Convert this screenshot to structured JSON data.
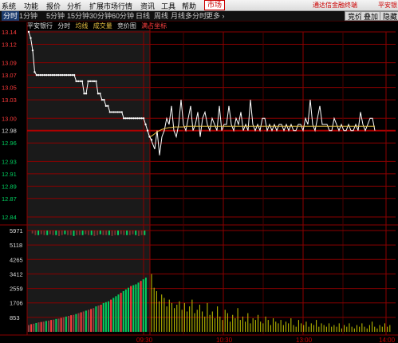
{
  "menu": {
    "items": [
      "系统",
      "功能",
      "报价",
      "分析",
      "扩展市场行情",
      "资讯",
      "工具",
      "帮助"
    ],
    "active_item": "市场",
    "right_text": "通达信金融终端",
    "right_text2": "平安银"
  },
  "toolbar": {
    "periods": [
      "分时",
      "1分钟",
      "5分钟",
      "15分钟",
      "30分钟",
      "60分钟",
      "日线",
      "周线",
      "月线",
      "多分时",
      "更多"
    ],
    "selected": "分时",
    "more_suffix": "›",
    "buttons": [
      "竞价",
      "叠加",
      "隐藏"
    ]
  },
  "info": {
    "stock_name": "平安银行",
    "mode": "分时",
    "avg_line": "均线",
    "volume": "成交量",
    "auction": "竞价图",
    "coord": "满占坐标"
  },
  "colors": {
    "up": "#ff3c3c",
    "down": "#00d060",
    "price_line": "#ffffff",
    "avg_line": "#e8c040",
    "grid": "#8b0000",
    "auction_bg": "#1a1a1a",
    "volume_bar": "#c8c800",
    "auction_volume": "#7a3030"
  },
  "chart_data": {
    "type": "line",
    "price_ticks": [
      "13.14",
      "13.12",
      "13.09",
      "13.07",
      "13.05",
      "13.03",
      "13.00",
      "12.98",
      "12.96",
      "12.93",
      "12.91",
      "12.89",
      "12.87",
      "12.84"
    ],
    "reference_price": 12.98,
    "volume_ticks": [
      "5971",
      "5118",
      "4265",
      "3412",
      "2559",
      "1706",
      "853"
    ],
    "time_labels": [
      "09:30",
      "10:30",
      "13:00",
      "14:00"
    ],
    "auction_price": [
      13.14,
      13.13,
      13.11,
      13.075,
      13.07,
      13.07,
      13.07,
      13.07,
      13.07,
      13.07,
      13.07,
      13.07,
      13.07,
      13.07,
      13.07,
      13.07,
      13.07,
      13.07,
      13.07,
      13.07,
      13.07,
      13.07,
      13.07,
      13.07,
      13.06,
      13.06,
      13.06,
      13.06,
      13.04,
      13.04,
      13.06,
      13.06,
      13.06,
      13.06,
      13.06,
      13.04,
      13.04,
      13.03,
      13.03,
      13.02,
      13.02,
      13.01,
      13.01,
      13.01,
      13.01,
      13.01,
      13.01,
      13.01,
      13.0,
      13.0,
      13.0,
      13.0,
      13.0,
      13.0,
      13.0,
      13.0,
      13.0,
      13.0,
      13.0,
      12.99,
      12.98,
      12.97,
      12.965
    ],
    "session_price": [
      12.97,
      12.96,
      12.95,
      12.98,
      12.94,
      12.97,
      12.98,
      13.0,
      12.99,
      13.02,
      12.98,
      12.97,
      12.99,
      13.03,
      12.99,
      12.98,
      13.0,
      13.02,
      12.98,
      12.99,
      13.01,
      12.97,
      13.0,
      13.01,
      12.99,
      12.98,
      13.0,
      12.99,
      12.98,
      13.02,
      12.98,
      12.99,
      12.99,
      13.02,
      12.99,
      12.98,
      13.0,
      12.99,
      13.01,
      12.98,
      12.99,
      12.98,
      13.03,
      12.99,
      12.98,
      12.99,
      12.98,
      13.0,
      13.0,
      12.98,
      12.99,
      12.98,
      12.99,
      12.98,
      12.99,
      12.99,
      12.98,
      12.99,
      12.98,
      12.99,
      12.98,
      12.98,
      12.99,
      12.99,
      12.98,
      13.0,
      12.99,
      13.03,
      12.99,
      12.98,
      13.0,
      13.02,
      12.99,
      12.99,
      12.99,
      12.98,
      12.98,
      13.0,
      12.99,
      12.98,
      12.99,
      12.98,
      12.98,
      12.99,
      12.98,
      12.98,
      12.99,
      12.98,
      13.01,
      12.99,
      12.98,
      12.99,
      13.0,
      13.0,
      12.98
    ],
    "session_avg": [
      12.97,
      12.972,
      12.975,
      12.978,
      12.98,
      12.982,
      12.983,
      12.984,
      12.985,
      12.985,
      12.986,
      12.986,
      12.986,
      12.986,
      12.986,
      12.987,
      12.987,
      12.987,
      12.987,
      12.987,
      12.987,
      12.987,
      12.987,
      12.987,
      12.987,
      12.987,
      12.987,
      12.987,
      12.987,
      12.987,
      12.987,
      12.987,
      12.987,
      12.987,
      12.987,
      12.987,
      12.987,
      12.987,
      12.987,
      12.987,
      12.987,
      12.987,
      12.987,
      12.987,
      12.987,
      12.987,
      12.987,
      12.987,
      12.987,
      12.987,
      12.987,
      12.987,
      12.987,
      12.987,
      12.987,
      12.987,
      12.987,
      12.987,
      12.987,
      12.987,
      12.987,
      12.987,
      12.987,
      12.987,
      12.987,
      12.987,
      12.987,
      12.987,
      12.987,
      12.987,
      12.987,
      12.987,
      12.987,
      12.987,
      12.987,
      12.987,
      12.987,
      12.987,
      12.987,
      12.987,
      12.987,
      12.987,
      12.987,
      12.987,
      12.987,
      12.987,
      12.987,
      12.987,
      12.987,
      12.987,
      12.987,
      12.987,
      12.987,
      12.987,
      12.987
    ],
    "auction_volume_top": [
      5971,
      5800,
      5700,
      5700,
      5750,
      5700,
      5700,
      5750,
      5700,
      5700,
      5650,
      5700,
      5750,
      5700,
      5700,
      5650,
      5700,
      5700,
      5700,
      5750,
      5700,
      5700,
      5650,
      5700,
      5750,
      5700,
      5700,
      5700,
      5650,
      5700,
      5700,
      5750,
      5700,
      5700,
      5700,
      5750,
      5700,
      5650,
      5700,
      5700
    ],
    "auction_volume_bottom": [
      400,
      450,
      480,
      520,
      560,
      580,
      600,
      640,
      660,
      700,
      720,
      760,
      780,
      820,
      860,
      900,
      940,
      980,
      1000,
      1050,
      1100,
      1150,
      1200,
      1250,
      1300,
      1350,
      1400,
      1500,
      1550,
      1600,
      1700,
      1750,
      1800,
      1900,
      2000,
      2100,
      2200,
      2300,
      2400,
      2500,
      2600,
      2700,
      2750,
      2800,
      2900,
      3000,
      3100,
      3200
    ],
    "session_volume": [
      3400,
      2600,
      2400,
      1800,
      2200,
      2000,
      1500,
      1900,
      1700,
      1400,
      1600,
      1800,
      1300,
      1700,
      1200,
      1500,
      1900,
      1100,
      1300,
      1600,
      1200,
      900,
      1700,
      1000,
      1200,
      800,
      1500,
      900,
      700,
      1300,
      1100,
      600,
      1000,
      800,
      1400,
      700,
      900,
      600,
      1100,
      500,
      800,
      700,
      1000,
      600,
      500,
      900,
      700,
      400,
      800,
      600,
      500,
      700,
      400,
      600,
      500,
      800,
      400,
      300,
      700,
      500,
      400,
      600,
      300,
      500,
      400,
      700,
      300,
      500,
      400,
      300,
      500,
      300,
      400,
      300,
      500,
      200,
      400,
      300,
      500,
      300,
      200,
      400,
      300,
      500,
      300,
      200,
      400,
      600,
      300,
      200,
      400,
      300,
      500,
      300,
      400
    ],
    "ylim": [
      12.84,
      13.14
    ],
    "vol_lim": [
      0,
      5971
    ]
  }
}
